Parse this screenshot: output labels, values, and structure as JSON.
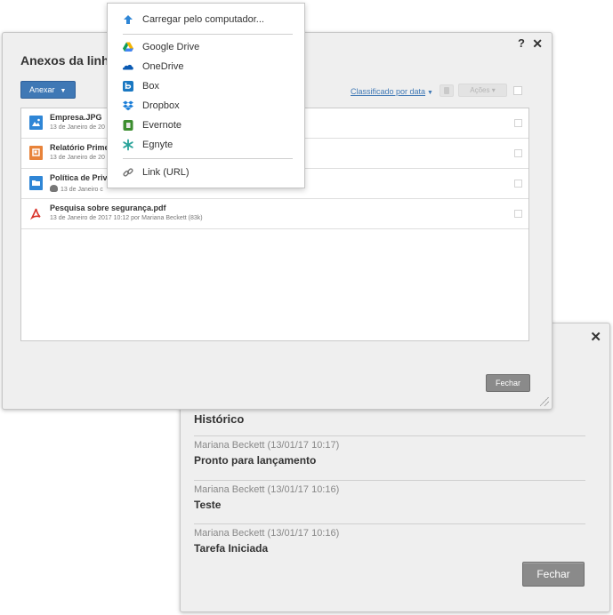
{
  "history": {
    "close_label": "✕",
    "title": "Histórico",
    "entries": [
      {
        "meta": "Mariana Beckett (13/01/17 10:17)",
        "text": "Pronto para lançamento"
      },
      {
        "meta": "Mariana Beckett (13/01/17 10:16)",
        "text": "Teste"
      },
      {
        "meta": "Mariana Beckett (13/01/17 10:16)",
        "text": "Tarefa Iniciada"
      }
    ],
    "close_button": "Fechar"
  },
  "attachments": {
    "help_label": "?",
    "close_label": "✕",
    "title": "Anexos da linh",
    "attach_button": "Anexar",
    "sort_label": "Classificado por data",
    "actions_label": "Ações",
    "files": [
      {
        "name": "Empresa.JPG",
        "meta": "13 de Janeiro de 20",
        "icon": "image-file-icon",
        "color": "#2f86d6"
      },
      {
        "name": "Relatório Primei",
        "meta": "13 de Janeiro de 20",
        "icon": "presentation-file-icon",
        "color": "#e8833a"
      },
      {
        "name": "Política de Priva",
        "meta": "13 de Janeiro c",
        "icon": "folder-file-icon",
        "color": "#2f86d6"
      },
      {
        "name": "Pesquisa sobre segurança.pdf",
        "meta": "13 de Janeiro de 2017 10:12 por Mariana Beckett (83k)",
        "icon": "pdf-file-icon",
        "color": "#d9342b"
      }
    ],
    "close_button": "Fechar"
  },
  "menu": {
    "items": [
      {
        "label": "Carregar pelo computador...",
        "icon": "upload-icon"
      },
      {
        "label": "Google Drive",
        "icon": "google-drive-icon"
      },
      {
        "label": "OneDrive",
        "icon": "onedrive-icon"
      },
      {
        "label": "Box",
        "icon": "box-icon"
      },
      {
        "label": "Dropbox",
        "icon": "dropbox-icon"
      },
      {
        "label": "Evernote",
        "icon": "evernote-icon"
      },
      {
        "label": "Egnyte",
        "icon": "egnyte-icon"
      },
      {
        "label": "Link (URL)",
        "icon": "link-icon"
      }
    ]
  },
  "colors": {
    "accent": "#3f78b5",
    "button_gray": "#8a8a8a"
  }
}
